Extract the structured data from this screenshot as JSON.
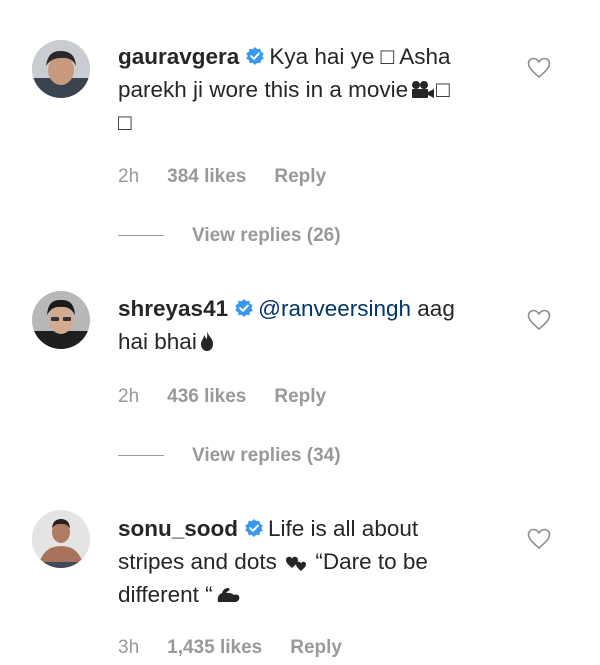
{
  "comments": [
    {
      "username": "gauravgera",
      "verified": true,
      "text_parts": [
        "Kya hai ye ",
        "□",
        " Asha parekh ji wore this in a movie ",
        "□"
      ],
      "line1": "Kya hai ye □ Asha",
      "line2": "parekh ji wore this in a movie",
      "line2_tail": "□",
      "line3": "□",
      "time": "2h",
      "likes": "384 likes",
      "reply_label": "Reply",
      "view_replies": "View replies (26)",
      "avatar_icon": "profile-photo"
    },
    {
      "username": "shreyas41",
      "verified": true,
      "mention": "@ranveersingh",
      "line1_tail": "aag",
      "line2": "hai bhai",
      "time": "2h",
      "likes": "436 likes",
      "reply_label": "Reply",
      "view_replies": "View replies (34)",
      "avatar_icon": "profile-photo"
    },
    {
      "username": "sonu_sood",
      "verified": true,
      "line1": "Life is all about",
      "line2": "stripes and dots",
      "line2_tail": "“Dare to be",
      "line3": "different “",
      "time": "3h",
      "likes": "1,435 likes",
      "reply_label": "Reply",
      "avatar_icon": "profile-photo"
    }
  ],
  "colors": {
    "text": "#262626",
    "muted": "#999999",
    "mention": "#003569",
    "verified": "#3897f0"
  }
}
